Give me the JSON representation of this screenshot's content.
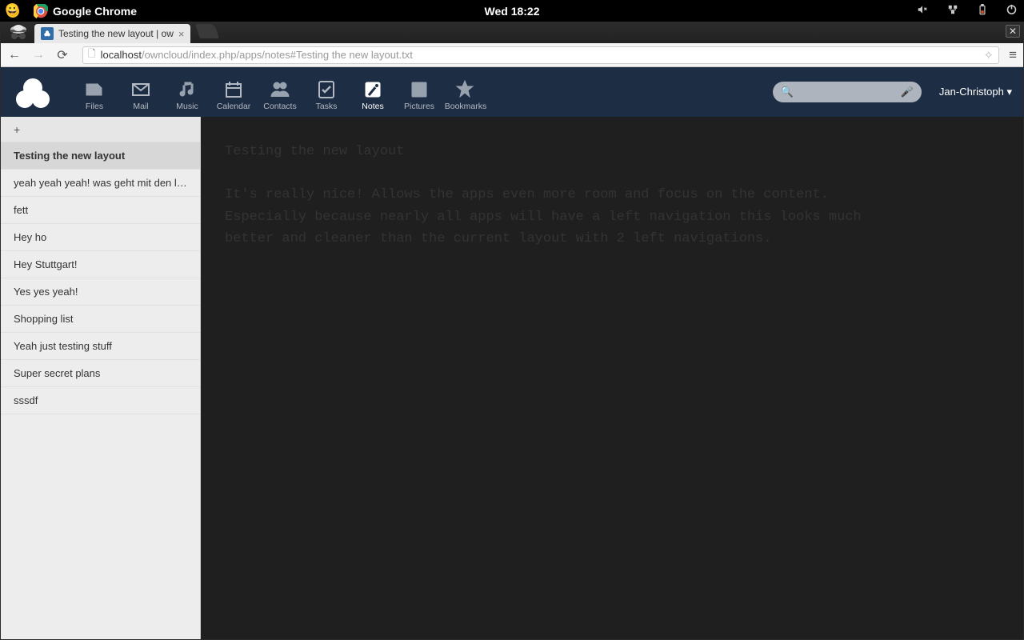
{
  "desktop": {
    "app_title": "Google Chrome",
    "clock": "Wed 18:22",
    "tray": {
      "volume": "🔈",
      "network": "🖧",
      "battery": "🔋",
      "power": "⏻"
    }
  },
  "browser": {
    "tab_title": "Testing the new layout | ow",
    "url_host": "localhost",
    "url_path": "/owncloud/index.php/apps/notes#Testing the new layout.txt",
    "win_close": "✕"
  },
  "owncloud": {
    "nav": [
      {
        "label": "Files"
      },
      {
        "label": "Mail"
      },
      {
        "label": "Music"
      },
      {
        "label": "Calendar"
      },
      {
        "label": "Contacts"
      },
      {
        "label": "Tasks"
      },
      {
        "label": "Notes"
      },
      {
        "label": "Pictures"
      },
      {
        "label": "Bookmarks"
      }
    ],
    "active_nav_index": 6,
    "user": "Jan-Christoph ▾",
    "sidebar_add": "+",
    "notes": [
      "Testing the new layout",
      "yeah yeah yeah! was geht mit den l…",
      "fett",
      "Hey ho",
      "Hey Stuttgart!",
      "Yes yes yeah!",
      "Shopping list",
      "Yeah just testing stuff",
      "Super secret plans",
      "sssdf"
    ],
    "active_note_index": 0,
    "note_content": "Testing the new layout\n\nIt's really nice! Allows the apps even more room and focus on the content. Especially because nearly all apps will have a left navigation this looks much better and cleaner than the current layout with 2 left navigations."
  }
}
